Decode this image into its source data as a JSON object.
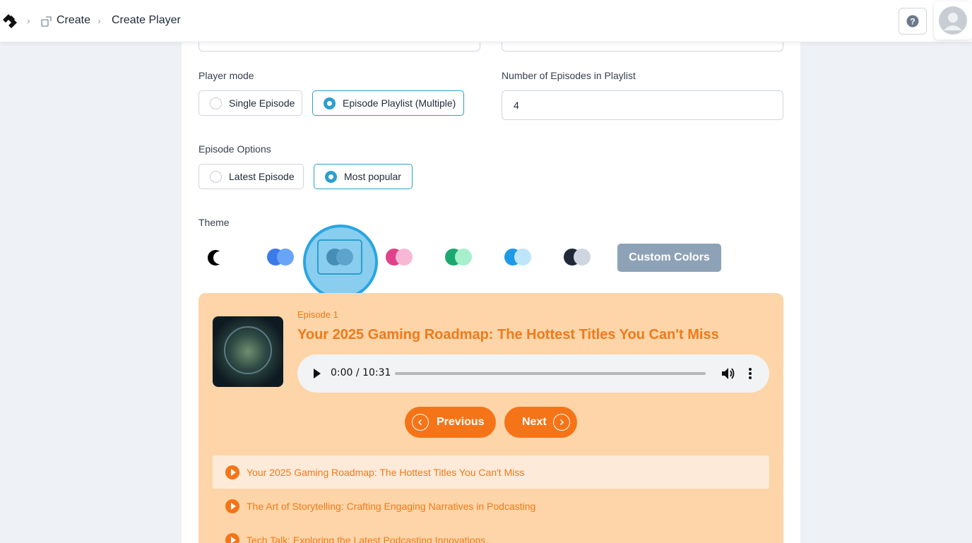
{
  "breadcrumb": {
    "items": [
      "Create",
      "Create Player"
    ]
  },
  "form": {
    "player_mode_label": "Player mode",
    "player_mode_options": [
      "Single Episode",
      "Episode Playlist (Multiple)"
    ],
    "player_mode_selected": "Episode Playlist (Multiple)",
    "episodes_count_label": "Number of Episodes in Playlist",
    "episodes_count_value": "4",
    "episode_options_label": "Episode Options",
    "episode_options": [
      "Latest Episode",
      "Most popular"
    ],
    "episode_options_selected": "Most popular",
    "theme_label": "Theme",
    "custom_colors_label": "Custom Colors"
  },
  "themes": [
    {
      "name": "dark-mode",
      "c1": "#000000",
      "c2": "#ffffff"
    },
    {
      "name": "blue",
      "c1": "#3b7be8",
      "c2": "#6aa4f8"
    },
    {
      "name": "gray",
      "c1": "#6b7280",
      "c2": "#9ca3af"
    },
    {
      "name": "pink",
      "c1": "#e0418b",
      "c2": "#f7b8d6"
    },
    {
      "name": "green",
      "c1": "#1ca870",
      "c2": "#a7f0cc"
    },
    {
      "name": "sky",
      "c1": "#1d9ae6",
      "c2": "#bfe5fb"
    },
    {
      "name": "slate",
      "c1": "#1f2937",
      "c2": "#cfd6e0"
    }
  ],
  "theme_selected": "gray",
  "colors": {
    "accent": "#2b9fcf",
    "player_bg": "#fdd5a8",
    "player_accent": "#f57418",
    "custom_button": "#8da2b6"
  },
  "player": {
    "episode_label": "Episode 1",
    "title": "Your 2025 Gaming Roadmap: The Hottest Titles You Can't Miss",
    "time": "0:00 / 10:31",
    "previous_label": "Previous",
    "next_label": "Next",
    "playlist": [
      "Your 2025 Gaming Roadmap: The Hottest Titles You Can't Miss",
      "The Art of Storytelling: Crafting Engaging Narratives in Podcasting",
      "Tech Talk: Exploring the Latest Podcasting Innovations"
    ]
  }
}
